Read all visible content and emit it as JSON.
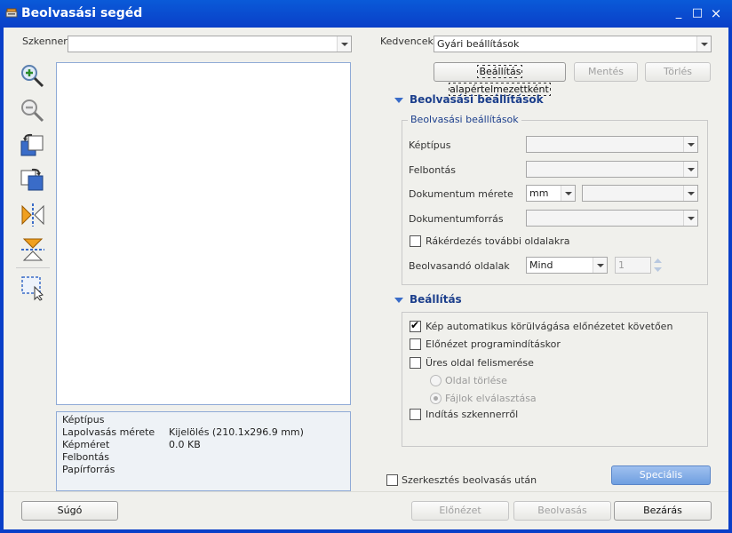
{
  "window": {
    "title": "Beolvasási segéd",
    "controls": [
      "_",
      "□",
      "×"
    ]
  },
  "scanner": {
    "label": "Szkenner",
    "value": ""
  },
  "favorites": {
    "label": "Kedvencek",
    "value": "Gyári beállítások"
  },
  "preset_buttons": {
    "set_default": "Beállítás alapértelmezettként",
    "save": "Mentés",
    "delete": "Törlés"
  },
  "tools": [
    "zoom-in-icon",
    "zoom-out-icon",
    "rotate-left-icon",
    "rotate-right-icon",
    "flip-horizontal-icon",
    "flip-vertical-icon",
    "selection-icon"
  ],
  "info": {
    "rows": [
      {
        "label": "Képtípus",
        "value": ""
      },
      {
        "label": "Lapolvasás mérete",
        "value": "Kijelölés (210.1x296.9 mm)"
      },
      {
        "label": "Képméret",
        "value": "0.0 KB"
      },
      {
        "label": "Felbontás",
        "value": ""
      },
      {
        "label": "Papírforrás",
        "value": ""
      }
    ]
  },
  "scan_settings": {
    "header": "Beolvasási beállítások",
    "group_title": "Beolvasási beállítások",
    "image_type_label": "Képtípus",
    "resolution_label": "Felbontás",
    "doc_size_label": "Dokumentum mérete",
    "doc_size_unit": "mm",
    "doc_source_label": "Dokumentumforrás",
    "prompt_more_pages": "Rákérdezés további oldalakra",
    "pages_label": "Beolvasandó oldalak",
    "pages_value": "Mind",
    "pages_count": "1"
  },
  "settings": {
    "header": "Beállítás",
    "auto_crop": "Kép automatikus körülvágása előnézetet követően",
    "preview_on_start": "Előnézet programindításkor",
    "blank_page_detect": "Üres oldal felismerése",
    "delete_page": "Oldal törlése",
    "split_files": "Fájlok elválasztása",
    "start_from_scanner": "Indítás szkennerről"
  },
  "special_button": "Speciális",
  "edit_after_scan": "Szerkesztés beolvasás után",
  "bottom": {
    "help": "Súgó",
    "preview": "Előnézet",
    "scan": "Beolvasás",
    "close": "Bezárás"
  }
}
